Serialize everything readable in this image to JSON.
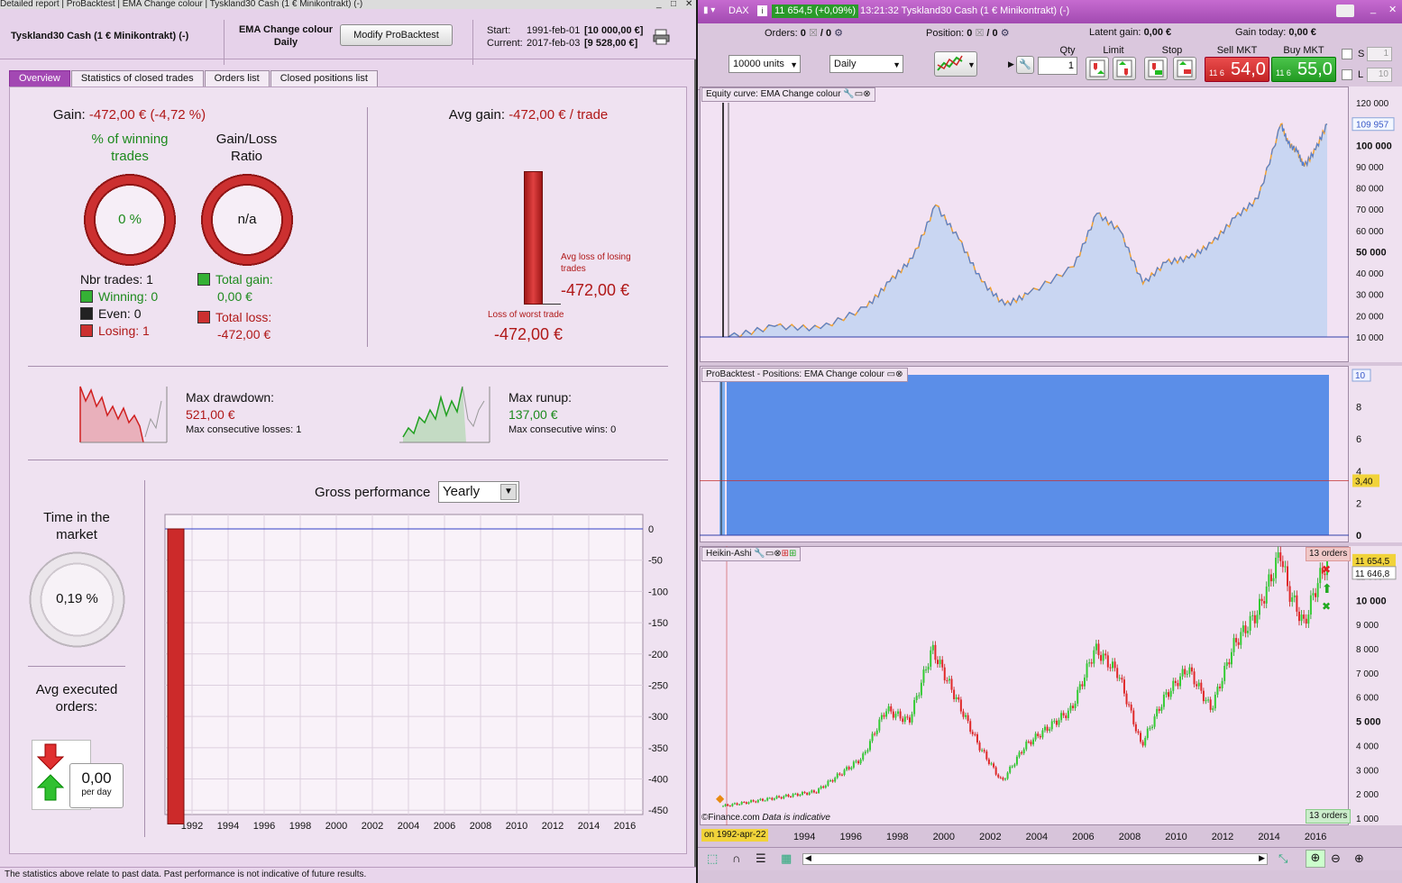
{
  "left_window": {
    "title_items": [
      "Detailed report",
      "ProBacktest",
      "EMA Change colour",
      "Tyskland30 Cash (1 € Minikontrakt) (-)"
    ],
    "instrument": "Tyskland30 Cash (1 € Minikontrakt) (-)",
    "strategy": "EMA Change colour",
    "timeframe": "Daily",
    "modify_button": "Modify ProBacktest",
    "start_label": "Start:",
    "start_date": "1991-feb-01",
    "start_value": "[10 000,00 €]",
    "current_label": "Current:",
    "current_date": "2017-feb-03",
    "current_value": "[9 528,00 €]",
    "tabs": [
      "Overview",
      "Statistics of closed trades",
      "Orders list",
      "Closed positions list"
    ],
    "gain_label": "Gain:",
    "gain_value": "-472,00 € (-4,72 %)",
    "avg_gain_label": "Avg gain:",
    "avg_gain_value": "-472,00 € / trade",
    "pct_winning_label": "% of winning trades",
    "pct_winning_value": "0 %",
    "gain_loss_label": "Gain/Loss Ratio",
    "gain_loss_value": "n/a",
    "nbr_trades": "Nbr trades: 1",
    "winning": "Winning: 0",
    "even": "Even: 0",
    "losing": "Losing: 1",
    "total_gain_label": "Total gain:",
    "total_gain_value": "0,00 €",
    "total_loss_label": "Total loss:",
    "total_loss_value": "-472,00 €",
    "avg_loss_label": "Avg loss of losing trades",
    "avg_loss_value": "-472,00 €",
    "worst_trade_label": "Loss of worst trade",
    "worst_trade_value": "-472,00 €",
    "max_drawdown_label": "Max drawdown:",
    "max_drawdown_value": "521,00 €",
    "max_consec_losses": "Max consecutive losses: 1",
    "max_runup_label": "Max runup:",
    "max_runup_value": "137,00 €",
    "max_consec_wins": "Max consecutive wins: 0",
    "time_in_market_label": "Time in the market",
    "time_in_market_value": "0,19 %",
    "avg_orders_label": "Avg executed orders:",
    "avg_orders_value": "0,00",
    "avg_orders_unit": "per day",
    "gross_perf_label": "Gross performance",
    "gross_perf_period": "Yearly",
    "footer": "The statistics above relate to past data. Past performance is not indicative of future results."
  },
  "chart_data": [
    {
      "type": "bar",
      "title": "Gross performance",
      "categories": [
        "1991"
      ],
      "values": [
        -472
      ],
      "ylim": [
        -480,
        0
      ],
      "yticks": [
        "0",
        "-50",
        "-100",
        "-150",
        "-200",
        "-250",
        "-300",
        "-350",
        "-400",
        "-450"
      ],
      "xticks": [
        "1992",
        "1994",
        "1996",
        "1998",
        "2000",
        "2002",
        "2004",
        "2006",
        "2008",
        "2010",
        "2012",
        "2014",
        "2016"
      ],
      "grid": true
    },
    {
      "type": "area",
      "title": "Equity curve: EMA Change colour",
      "x": [
        1991,
        1993,
        1995,
        1997,
        1998,
        1999,
        2000,
        2001,
        2002,
        2003,
        2004,
        2006,
        2007,
        2008,
        2009,
        2010,
        2011,
        2012,
        2013,
        2014,
        2015,
        2015.3,
        2015.7,
        2016,
        2016.5,
        2017
      ],
      "values": [
        10000,
        15000,
        14000,
        24000,
        36000,
        47000,
        72000,
        56000,
        36000,
        25000,
        30000,
        43000,
        68000,
        60000,
        35000,
        45000,
        47000,
        54000,
        66000,
        75000,
        110000,
        101000,
        97000,
        90000,
        98000,
        109957
      ],
      "yticks": [
        "120 000",
        "110 000",
        "100 000",
        "90 000",
        "80 000",
        "70 000",
        "60 000",
        "50 000",
        "40 000",
        "30 000",
        "20 000",
        "10 000"
      ],
      "ylim": [
        10000,
        120000
      ],
      "last_value": "109 957"
    },
    {
      "type": "bar",
      "title": "ProBacktest - Positions: EMA Change colour",
      "yticks": [
        "10",
        "8",
        "6",
        "4",
        "2",
        "0"
      ],
      "ylim": [
        0,
        10
      ],
      "level_marker": "3,40"
    },
    {
      "type": "line",
      "title": "Heikin-Ashi",
      "x": [
        1991,
        1993,
        1995,
        1997,
        1998,
        1999,
        2000,
        2001,
        2002,
        2003,
        2004,
        2006,
        2007,
        2008,
        2009,
        2010,
        2011,
        2012,
        2013,
        2014,
        2015,
        2015.3,
        2016,
        2016.5,
        2017
      ],
      "values": [
        1500,
        1800,
        2100,
        3500,
        5500,
        5000,
        8000,
        6000,
        4000,
        2500,
        4000,
        5500,
        8000,
        7000,
        4000,
        6000,
        7200,
        5500,
        8200,
        9500,
        12000,
        10500,
        9000,
        10500,
        11654
      ],
      "yticks": [
        "11 000",
        "10 000",
        "9 000",
        "8 000",
        "7 000",
        "6 000",
        "5 000",
        "4 000",
        "3 000",
        "2 000",
        "1 000"
      ],
      "xticks": [
        "1994",
        "1996",
        "1998",
        "2000",
        "2002",
        "2004",
        "2006",
        "2008",
        "2010",
        "2012",
        "2014",
        "2016"
      ],
      "price_tag": "11 654,5",
      "price_tag2": "11 646,8",
      "orders_tag": "13 orders",
      "date_tag": "on 1992-apr-22",
      "watermark": "Data is indicative",
      "source": "©Finance.com"
    }
  ],
  "right_window": {
    "instrument": "DAX",
    "price_badge": "11 654,5 (+0,09%)",
    "time_title": "13:21:32 Tyskland30 Cash (1 € Minikontrakt) (-)",
    "orders_label": "Orders:",
    "orders_value": "0",
    "orders_value2": "/ 0",
    "position_label": "Position:",
    "position_value": "0",
    "position_value2": "/ 0",
    "latent_label": "Latent gain:",
    "latent_value": "0,00 €",
    "gain_today_label": "Gain today:",
    "gain_today_value": "0,00 €",
    "units": "10000 units",
    "timeframe": "Daily",
    "qty_label": "Qty",
    "qty_value": "1",
    "limit_label": "Limit",
    "stop_label": "Stop",
    "sell_label": "Sell MKT",
    "sell_prefix": "11 6",
    "sell_value": "54,0",
    "buy_label": "Buy MKT",
    "buy_prefix": "11 6",
    "buy_value": "55,0",
    "s_label": "S",
    "s_value": "1",
    "l_label": "L",
    "l_value": "10"
  }
}
